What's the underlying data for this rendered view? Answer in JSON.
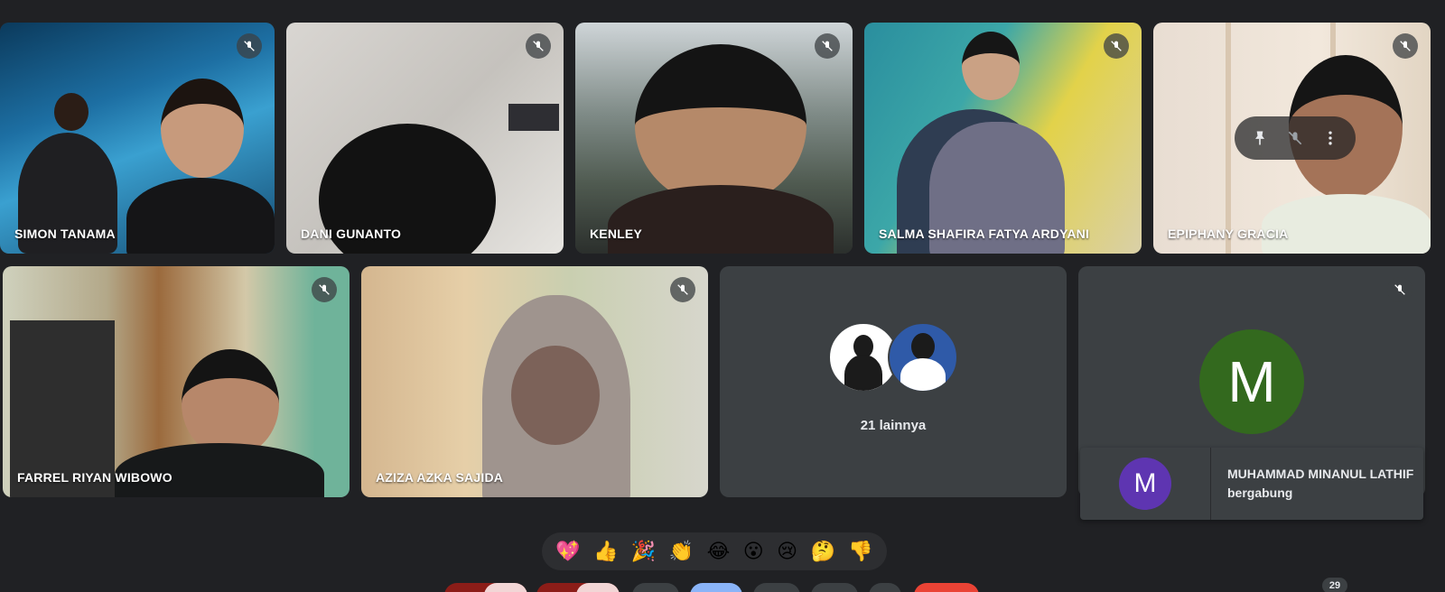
{
  "participants_row1": [
    {
      "name": "SIMON TANAMA"
    },
    {
      "name": "DANI GUNANTO"
    },
    {
      "name": "KENLEY"
    },
    {
      "name": "SALMA SHAFIRA FATYA ARDYANI"
    },
    {
      "name": "EPIPHANY GRACIA"
    }
  ],
  "participants_row2": [
    {
      "name": "FARREL RIYAN WIBOWO"
    },
    {
      "name": "AZIZA AZKA SAJIDA"
    }
  ],
  "others": {
    "label": "21 lainnya"
  },
  "solo": {
    "initial": "M"
  },
  "toast": {
    "initial": "M",
    "text": "MUHAMMAD MINANUL LATHIF bergabung"
  },
  "reactions": [
    "💖",
    "👍",
    "🎉",
    "👏",
    "😂",
    "😮",
    "😢",
    "🤔",
    "👎"
  ],
  "participant_count": "29",
  "colors": {
    "background": "#202124",
    "tile": "#3c4043",
    "solo_avatar": "#33691e",
    "toast_avatar": "#5e35b1",
    "leave": "#ea4335"
  }
}
